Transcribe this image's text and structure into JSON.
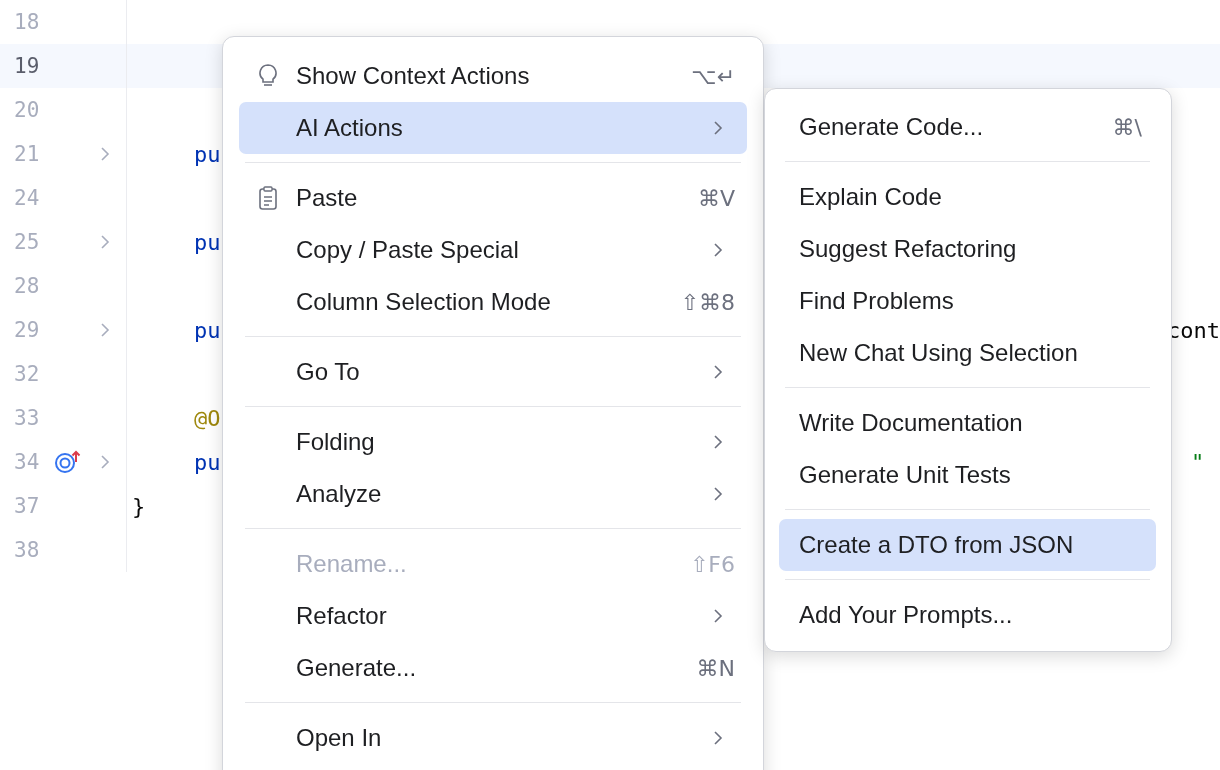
{
  "editor": {
    "lines": [
      {
        "number": "18",
        "current": false,
        "collapsed": false,
        "marker": false
      },
      {
        "number": "19",
        "current": true,
        "collapsed": false,
        "marker": false
      },
      {
        "number": "20",
        "current": false,
        "collapsed": false,
        "marker": false
      },
      {
        "number": "21",
        "current": false,
        "collapsed": true,
        "marker": false,
        "code": [
          {
            "text": "pu",
            "kind": "keyword"
          }
        ]
      },
      {
        "number": "24",
        "current": false,
        "collapsed": false,
        "marker": false
      },
      {
        "number": "25",
        "current": false,
        "collapsed": true,
        "marker": false,
        "code": [
          {
            "text": "pu",
            "kind": "keyword"
          }
        ]
      },
      {
        "number": "28",
        "current": false,
        "collapsed": false,
        "marker": false
      },
      {
        "number": "29",
        "current": false,
        "collapsed": true,
        "marker": false,
        "code": [
          {
            "text": "pu",
            "kind": "keyword"
          }
        ],
        "tail": {
          "text": "cont",
          "kind": "plain"
        }
      },
      {
        "number": "32",
        "current": false,
        "collapsed": false,
        "marker": false
      },
      {
        "number": "33",
        "current": false,
        "collapsed": false,
        "marker": false,
        "code": [
          {
            "text": "@O",
            "kind": "annotation"
          }
        ]
      },
      {
        "number": "34",
        "current": false,
        "collapsed": true,
        "marker": true,
        "code": [
          {
            "text": "pu",
            "kind": "keyword"
          }
        ],
        "tail": {
          "text": "\"",
          "kind": "string"
        }
      },
      {
        "number": "37",
        "current": false,
        "collapsed": false,
        "marker": false,
        "code": [
          {
            "text": "}",
            "kind": "brace"
          }
        ]
      },
      {
        "number": "38",
        "current": false,
        "collapsed": false,
        "marker": false
      }
    ]
  },
  "context_menu": {
    "groups": [
      [
        {
          "label": "Show Context Actions",
          "shortcut": "⌥↵",
          "submenu": false,
          "selected": false,
          "disabled": false
        },
        {
          "label": "AI Actions",
          "submenu": true,
          "selected": true,
          "disabled": false
        }
      ],
      [
        {
          "label": "Paste",
          "shortcut": "⌘V",
          "submenu": false,
          "selected": false,
          "disabled": false
        },
        {
          "label": "Copy / Paste Special",
          "submenu": true,
          "selected": false,
          "disabled": false
        },
        {
          "label": "Column Selection Mode",
          "shortcut": "⇧⌘8",
          "submenu": false,
          "selected": false,
          "disabled": false
        }
      ],
      [
        {
          "label": "Go To",
          "submenu": true,
          "selected": false,
          "disabled": false
        }
      ],
      [
        {
          "label": "Folding",
          "submenu": true,
          "selected": false,
          "disabled": false
        },
        {
          "label": "Analyze",
          "submenu": true,
          "selected": false,
          "disabled": false
        }
      ],
      [
        {
          "label": "Rename...",
          "shortcut": "⇧F6",
          "submenu": false,
          "selected": false,
          "disabled": true
        },
        {
          "label": "Refactor",
          "submenu": true,
          "selected": false,
          "disabled": false
        },
        {
          "label": "Generate...",
          "shortcut": "⌘N",
          "submenu": false,
          "selected": false,
          "disabled": false
        }
      ],
      [
        {
          "label": "Open In",
          "submenu": true,
          "selected": false,
          "disabled": false
        }
      ]
    ]
  },
  "submenu": {
    "groups": [
      [
        {
          "label": "Generate Code...",
          "shortcut": "⌘\\",
          "selected": false
        }
      ],
      [
        {
          "label": "Explain Code",
          "selected": false
        },
        {
          "label": "Suggest Refactoring",
          "selected": false
        },
        {
          "label": "Find Problems",
          "selected": false
        },
        {
          "label": "New Chat Using Selection",
          "selected": false
        }
      ],
      [
        {
          "label": "Write Documentation",
          "selected": false
        },
        {
          "label": "Generate Unit Tests",
          "selected": false
        }
      ],
      [
        {
          "label": "Create a DTO from JSON",
          "selected": true
        }
      ],
      [
        {
          "label": "Add Your Prompts...",
          "selected": false
        }
      ]
    ]
  }
}
